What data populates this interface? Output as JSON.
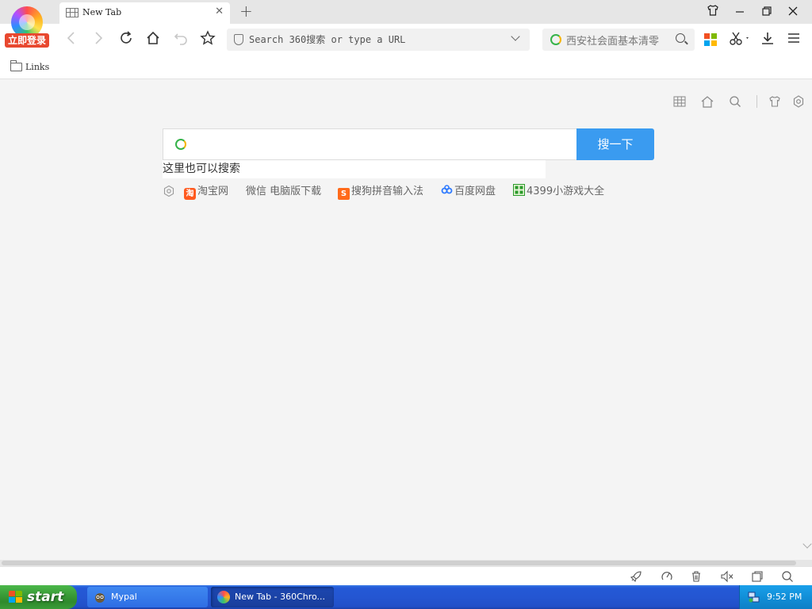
{
  "browser": {
    "login_badge": "立即登录",
    "tabs": [
      {
        "title": "New Tab"
      }
    ],
    "new_tab_symbol": "+",
    "address_placeholder": "Search 360搜索 or type a URL",
    "search_box_text": "西安社会面基本清零",
    "bookmarks": [
      {
        "label": "Links"
      }
    ]
  },
  "newtab_page": {
    "search_button": "搜一下",
    "search_hint": "这里也可以搜索",
    "quick_links": [
      {
        "label": "淘宝网",
        "icon": "taobao-icon",
        "color": "#ff5a1f",
        "glyph": "淘"
      },
      {
        "label": "微信 电脑版下载",
        "icon": "",
        "color": "",
        "glyph": ""
      },
      {
        "label": "搜狗拼音输入法",
        "icon": "sogou-icon",
        "color": "#ff6a1a",
        "glyph": "S"
      },
      {
        "label": "百度网盘",
        "icon": "baidu-netdisk-icon",
        "color": "#2f7bff",
        "glyph": ""
      },
      {
        "label": "4399小游戏大全",
        "icon": "4399-icon",
        "color": "#2a9a2a",
        "glyph": ""
      }
    ]
  },
  "taskbar": {
    "start_label": "start",
    "items": [
      {
        "label": "Mypal",
        "icon": "mypal-icon"
      },
      {
        "label": "New Tab - 360Chro...",
        "icon": "360chrome-icon"
      }
    ],
    "clock": "9:52 PM"
  },
  "colors": {
    "accent": "#3a9bf0",
    "login_badge": "#e8482f",
    "taskbar": "#2456d2",
    "start_button": "#3a9c38"
  }
}
